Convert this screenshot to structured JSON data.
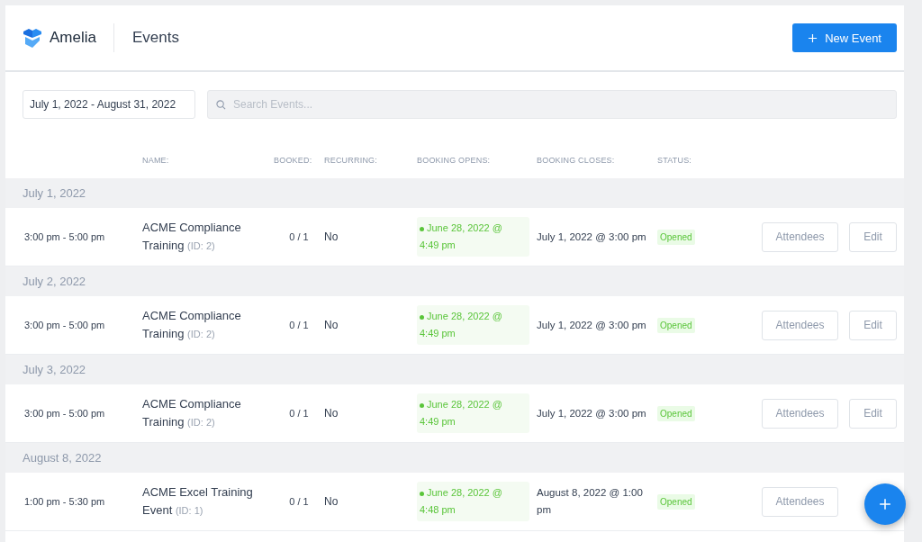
{
  "header": {
    "brand": "Amelia",
    "title": "Events",
    "new_button": "New Event"
  },
  "filters": {
    "date_range": "July 1, 2022 - August 31, 2022",
    "search_placeholder": "Search Events..."
  },
  "columns": [
    "NAME:",
    "BOOKED:",
    "RECURRING:",
    "BOOKING OPENS:",
    "BOOKING CLOSES:",
    "STATUS:"
  ],
  "groups": [
    {
      "date": "July 1, 2022",
      "events": [
        {
          "time": "3:00 pm - 5:00 pm",
          "name": "ACME Compliance Training",
          "id": "(ID: 2)",
          "booked": "0 / 1",
          "recurring": "No",
          "opens": "June 28, 2022 @ 4:49 pm",
          "closes": "July 1, 2022 @ 3:00 pm",
          "status": "Opened",
          "actions": [
            "Attendees",
            "Edit"
          ]
        }
      ]
    },
    {
      "date": "July 2, 2022",
      "events": [
        {
          "time": "3:00 pm - 5:00 pm",
          "name": "ACME Compliance Training",
          "id": "(ID: 2)",
          "booked": "0 / 1",
          "recurring": "No",
          "opens": "June 28, 2022 @ 4:49 pm",
          "closes": "July 1, 2022 @ 3:00 pm",
          "status": "Opened",
          "actions": [
            "Attendees",
            "Edit"
          ]
        }
      ]
    },
    {
      "date": "July 3, 2022",
      "events": [
        {
          "time": "3:00 pm - 5:00 pm",
          "name": "ACME Compliance Training",
          "id": "(ID: 2)",
          "booked": "0 / 1",
          "recurring": "No",
          "opens": "June 28, 2022 @ 4:49 pm",
          "closes": "July 1, 2022 @ 3:00 pm",
          "status": "Opened",
          "actions": [
            "Attendees",
            "Edit"
          ]
        }
      ]
    },
    {
      "date": "August 8, 2022",
      "events": [
        {
          "time": "1:00 pm - 5:30 pm",
          "name": "ACME Excel Training Event",
          "id": "(ID: 1)",
          "booked": "0 / 1",
          "recurring": "No",
          "opens": "June 28, 2022 @ 4:48 pm",
          "closes": "August 8, 2022 @ 1:00 pm",
          "status": "Opened",
          "actions": [
            "Attendees"
          ]
        }
      ]
    }
  ]
}
